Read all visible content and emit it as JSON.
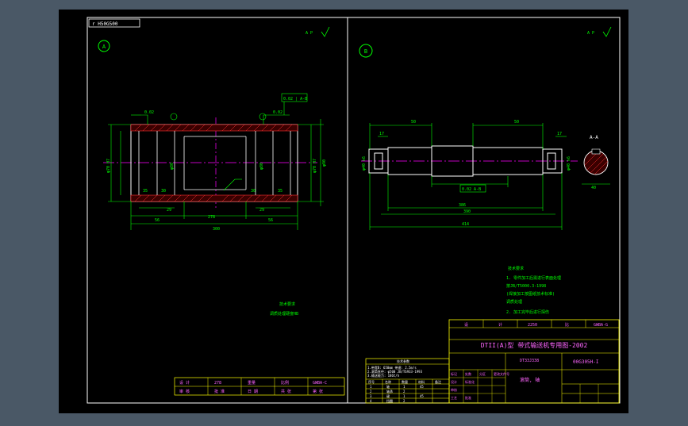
{
  "colors": {
    "background": "#000000",
    "frame": "#ffffff",
    "part": "#ffffff",
    "dimension": "#00ff00",
    "centerline": "#ff00ff",
    "title_text": "#ff66ff",
    "table": "#ffff00",
    "hatch": "#ff3333"
  },
  "header": {
    "drawing_code": "r H50G500"
  },
  "views": {
    "a": {
      "label": "A",
      "roughness": "A P",
      "dims": {
        "bottom_total": "300",
        "bottom_left": "56",
        "bottom_mid": "278",
        "bottom_right": "56",
        "small_left": "29",
        "small_right": "29",
        "top_left": "0.02",
        "top_right": "0.02",
        "left_dia": "φ70 H7",
        "right_dia": "φ70 H7",
        "inner_left": "φ80",
        "inner_right": "φ80",
        "right_outer": "φ90",
        "groove_l1": "35",
        "groove_l2": "30",
        "groove_r1": "30",
        "groove_r2": "35",
        "tol_box": "0.02 | A-B"
      }
    },
    "b": {
      "label": "B",
      "roughness": "A P",
      "section_label": "A-A",
      "dims": {
        "top_left": "50",
        "top_right": "50",
        "total": "414",
        "overall": "386",
        "mid": "390",
        "left_small": "17",
        "right_small": "17",
        "key_len": "50",
        "tol_box": "0.02 A-B",
        "left_dia": "φ40 k6",
        "right_dia": "φ40 k6",
        "section_dim": "40"
      }
    }
  },
  "notes_left": {
    "title": "技术要求",
    "line1": "调质处理硬度HB"
  },
  "notes_right": {
    "title": "技术要求",
    "line1": "1. 零件加工后需进行表面处理",
    "line2": "   按JB/T5000.3-1998",
    "line3": "   (焊接加工按图纸技术标准)",
    "line4": "   调质处理",
    "line5": "2. 加工完毕后进行探伤"
  },
  "title_block_left": {
    "cells": [
      "设 计",
      "278",
      "重量",
      "比例",
      "GWBA-C"
    ],
    "row2": [
      "审 核",
      "批 准",
      "日 期",
      "共 张",
      "第 张"
    ]
  },
  "spec_table": {
    "header": "技术参数",
    "lines": [
      "1.带宽B: 650mm  带速: 2.5m/s",
      "2.滚筒直径: φ500  JB/T6933-1993",
      "3.输送能力: 186t/h"
    ],
    "grid_header": [
      "序号",
      "名称",
      "数量",
      "材料",
      "备注"
    ],
    "rows": [
      [
        "1",
        "轴",
        "1",
        "45",
        ""
      ],
      [
        "2",
        "轴承",
        "2",
        "",
        ""
      ],
      [
        "3",
        "键",
        "1",
        "45",
        ""
      ],
      [
        "4",
        "挡圈",
        "2",
        "",
        ""
      ]
    ],
    "footer": "文件编号"
  },
  "title_block_right": {
    "top_row": [
      "设",
      "计",
      "2250",
      "比",
      "GWBA-G"
    ],
    "title": "DTII(A)型  带式输送机专用图-2002",
    "code_left": "DT33J338",
    "code_right": "00G305H-I",
    "part_name": "滚筒, 轴",
    "small_rows": [
      [
        "标记",
        "处数",
        "分区",
        "更改文件号"
      ],
      [
        "设计",
        "标准化",
        "",
        ""
      ],
      [
        "审核",
        "",
        "",
        ""
      ],
      [
        "工艺",
        "批准",
        "",
        ""
      ]
    ]
  }
}
